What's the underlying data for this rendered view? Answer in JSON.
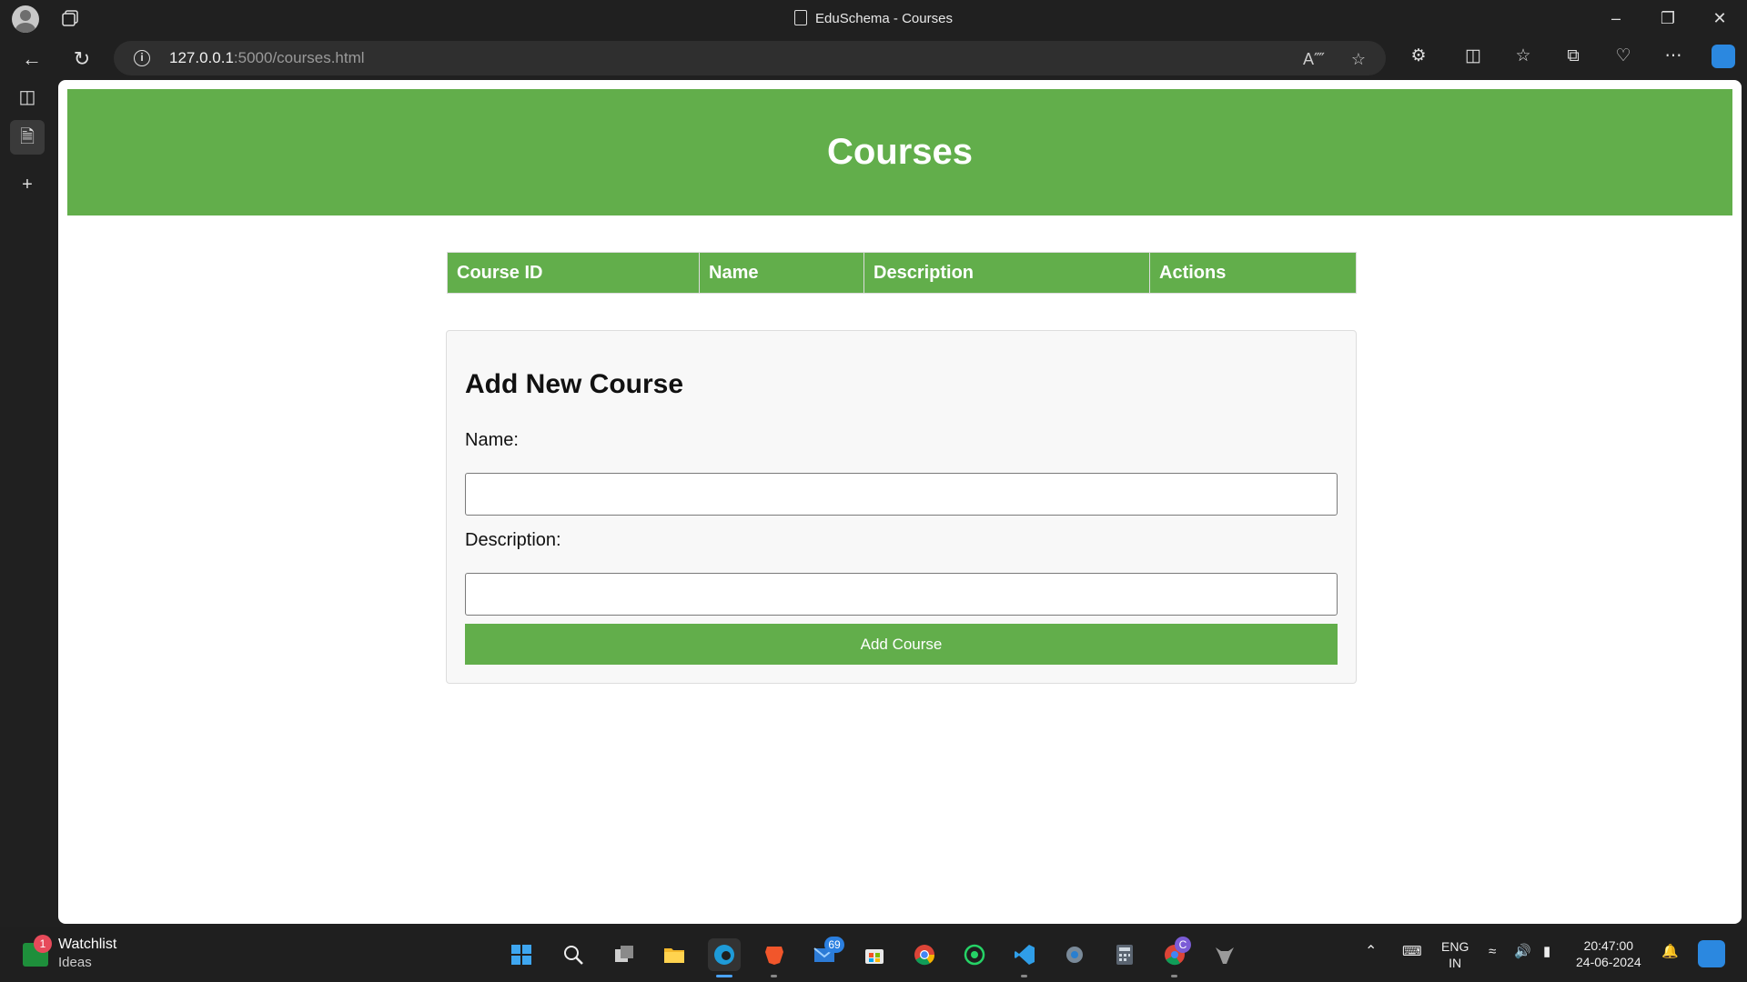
{
  "browser": {
    "window_title": "EduSchema - Courses",
    "url_host": "127.0.0.1",
    "url_rest": ":5000/courses.html"
  },
  "page": {
    "header_title": "Courses",
    "table_headers": [
      "Course ID",
      "Name",
      "Description",
      "Actions"
    ],
    "form": {
      "title": "Add New Course",
      "name_label": "Name:",
      "name_value": "",
      "description_label": "Description:",
      "description_value": "",
      "submit_label": "Add Course"
    }
  },
  "taskbar": {
    "widget_title": "Watchlist",
    "widget_subtitle": "Ideas",
    "widget_badge": "1",
    "mail_badge": "69",
    "chrome_profile_badge": "C",
    "language_top": "ENG",
    "language_bottom": "IN",
    "time": "20:47:00",
    "date": "24-06-2024"
  },
  "colors": {
    "accent_green": "#62ae4b",
    "browser_chrome": "#202020"
  }
}
